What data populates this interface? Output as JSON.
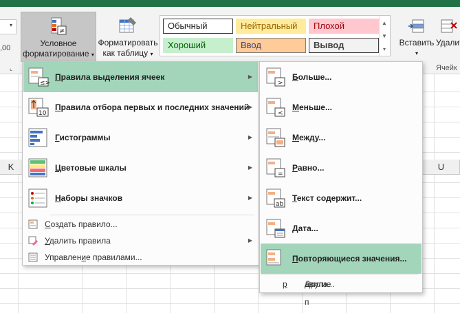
{
  "ribbon": {
    "conditional_formatting": {
      "line1": "Условное",
      "line2": "форматирование"
    },
    "format_as_table": {
      "line1": "Форматировать",
      "line2": "как таблицу"
    },
    "left_fragments": {
      "decimal": ",00",
      "expand": "⌐"
    },
    "cell_styles": [
      {
        "label": "Обычный",
        "bg": "#ffffff",
        "color": "#222222",
        "border": "#333333"
      },
      {
        "label": "Нейтральный",
        "bg": "#ffeb9c",
        "color": "#9c6500",
        "border": "#ffeb9c"
      },
      {
        "label": "Плохой",
        "bg": "#ffc7ce",
        "color": "#9c0006",
        "border": "#ffc7ce"
      },
      {
        "label": "Хороший",
        "bg": "#c6efce",
        "color": "#006100",
        "border": "#c6efce"
      },
      {
        "label": "Ввод",
        "bg": "#ffcc99",
        "color": "#3f3f76",
        "border": "#7f7f7f"
      },
      {
        "label": "Вывод",
        "bg": "#f2f2f2",
        "color": "#3f3f3f",
        "border": "#3f3f3f"
      }
    ],
    "insert": "Вставить",
    "delete": "Удалить",
    "cells_group": "Ячейк"
  },
  "columns": {
    "k": "K",
    "u": "U"
  },
  "main_menu": {
    "items": [
      {
        "label": "Правила выделения ячеек",
        "underline": "П",
        "rest": "равила выделения ячеек"
      },
      {
        "label": "Правила отбора первых и последних значений",
        "underline": "П",
        "rest": "равила отбора первых и последних значений"
      },
      {
        "label": "Гистограммы",
        "underline": "Г",
        "rest": "истограммы"
      },
      {
        "label": "Цветовые шкалы",
        "underline": "Ц",
        "rest": "ветовые шкалы",
        "pre": ""
      },
      {
        "label": "Наборы значков",
        "underline": "Н",
        "rest": "аборы значков"
      }
    ],
    "small": [
      {
        "label": "Создать правило...",
        "pre": "",
        "underline": "С",
        "rest": "оздать правило..."
      },
      {
        "label": "Удалить правила",
        "pre": "",
        "underline": "У",
        "rest": "далить правила"
      },
      {
        "label": "Управление правилами...",
        "pre": "Управлен",
        "underline": "и",
        "rest": "е правилами..."
      }
    ]
  },
  "sub_menu": {
    "items": [
      {
        "label": "Больше...",
        "underline": "Б",
        "rest": "ольше..."
      },
      {
        "label": "Меньше...",
        "underline": "М",
        "rest": "еньше..."
      },
      {
        "label": "Между...",
        "underline": "М",
        "rest": "ежду..."
      },
      {
        "label": "Равно...",
        "underline": "Р",
        "rest": "авно..."
      },
      {
        "label": "Текст содержит...",
        "underline": "Т",
        "rest": "екст содержит..."
      },
      {
        "label": "Дата...",
        "underline": "Д",
        "rest": "ата..."
      },
      {
        "label": "Повторяющиеся значения...",
        "underline": "П",
        "rest": "овторяющиеся значения..."
      }
    ],
    "other": {
      "label": "Другие правила...",
      "pre": "Другие п",
      "underline": "р",
      "rest": "авила..."
    }
  },
  "colors": {
    "highlight": "#a2d5b9",
    "excel_green": "#217346"
  }
}
